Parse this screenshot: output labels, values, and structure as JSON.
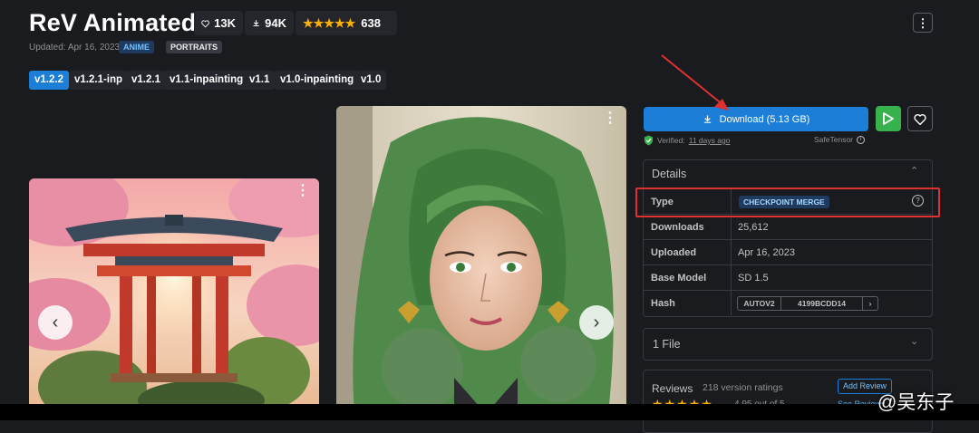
{
  "header": {
    "title": "ReV Animated",
    "likes": "13K",
    "downloads": "94K",
    "rating_count": "638",
    "updated": "Updated: Apr 16, 2023",
    "tags": [
      "ANIME",
      "PORTRAITS"
    ]
  },
  "versions": [
    "v1.2.2",
    "v1.2.1-inp",
    "v1.2.1",
    "v1.1-inpainting",
    "v1.1",
    "v1.0-inpainting",
    "v1.0"
  ],
  "download": {
    "label": "Download (5.13 GB)",
    "verified_prefix": "Verified:",
    "verified_time": "11 days ago",
    "format": "SafeTensor"
  },
  "details": {
    "title": "Details",
    "rows": [
      {
        "label": "Type",
        "value": "CHECKPOINT MERGE"
      },
      {
        "label": "Downloads",
        "value": "25,612"
      },
      {
        "label": "Uploaded",
        "value": "Apr 16, 2023"
      },
      {
        "label": "Base Model",
        "value": "SD 1.5"
      },
      {
        "label": "Hash",
        "hash_type": "AUTOV2",
        "hash_value": "4199BCDD14"
      }
    ]
  },
  "files": {
    "label": "1 File"
  },
  "reviews": {
    "title": "Reviews",
    "count": "218 version ratings",
    "add_button": "Add Review",
    "rating_partial": "4.95 out of 5",
    "see_reviews": "See Reviews"
  },
  "watermark": "@吴东子",
  "colors": {
    "accent": "#1c7ed6",
    "annotation": "#e03131",
    "star": "#fab005",
    "play": "#37b24d"
  }
}
